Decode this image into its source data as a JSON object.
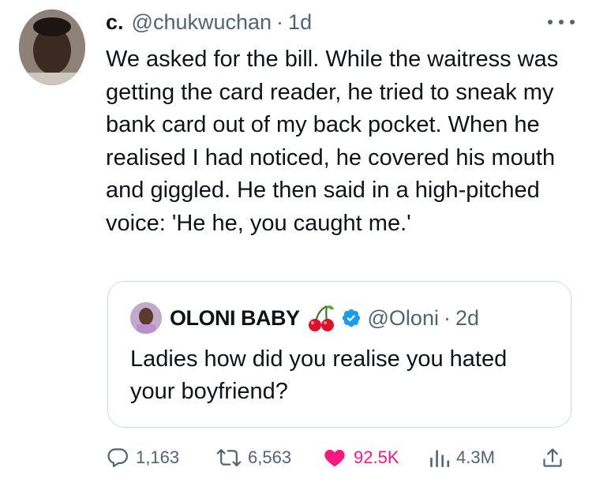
{
  "tweet": {
    "display_name": "c.",
    "handle": "@chukwuchan",
    "separator": "·",
    "time": "1d",
    "text": "We asked for the bill. While the waitress was getting the card reader, he tried to sneak my bank card out of my back pocket. When he realised I had noticed, he covered his mouth and giggled. He then said in a high-pitched voice: 'He he, you caught me.'"
  },
  "quoted_tweet": {
    "display_name": "OLONI BABY",
    "emoji": "cherries",
    "verified": true,
    "handle": "@Oloni",
    "separator": "·",
    "time": "2d",
    "text": "Ladies how did you realise you hated your boyfriend?"
  },
  "actions": {
    "replies": "1,163",
    "retweets": "6,563",
    "likes": "92.5K",
    "views": "4.3M"
  },
  "icons": [
    "more-icon",
    "reply-icon",
    "retweet-icon",
    "like-icon",
    "views-icon",
    "share-icon",
    "verified-badge-icon",
    "cherries-icon"
  ],
  "colors": {
    "text": "#0f1419",
    "secondary": "#536471",
    "like": "#f91880",
    "verified": "#1d9bf0",
    "border": "#cfd9de"
  }
}
